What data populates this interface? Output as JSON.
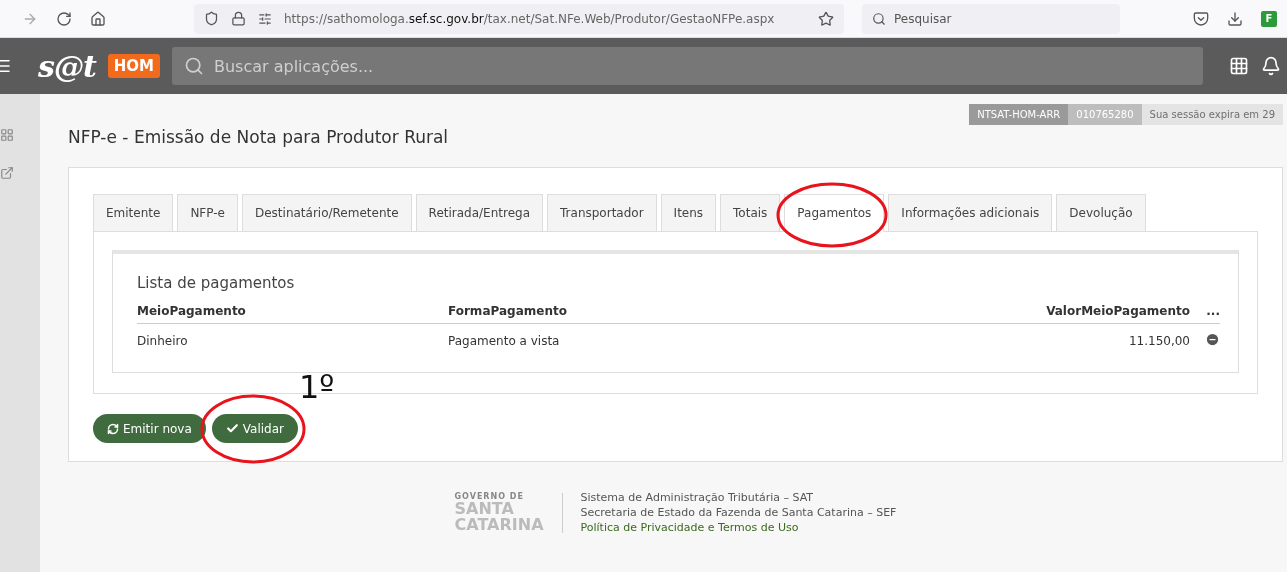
{
  "browser": {
    "url_prefix": "https://sathomologa.",
    "url_domain": "sef.sc.gov.br",
    "url_path": "/tax.net/Sat.NFe.Web/Produtor/GestaoNFPe.aspx",
    "search_placeholder": "Pesquisar",
    "extension_label": "F"
  },
  "header": {
    "logo": "s@t",
    "env_badge": "HOM",
    "search_placeholder": "Buscar aplicações..."
  },
  "session": [
    "NTSAT-HOM-ARR",
    "010765280",
    "Sua sessão expira em 29"
  ],
  "page_title": "NFP-e - Emissão de Nota para Produtor Rural",
  "tabs": [
    {
      "label": "Emitente",
      "selected": false,
      "circled": false
    },
    {
      "label": "NFP-e",
      "selected": false,
      "circled": false
    },
    {
      "label": "Destinatário/Remetente",
      "selected": false,
      "circled": false
    },
    {
      "label": "Retirada/Entrega",
      "selected": false,
      "circled": false
    },
    {
      "label": "Transportador",
      "selected": false,
      "circled": false
    },
    {
      "label": "Itens",
      "selected": false,
      "circled": false
    },
    {
      "label": "Totais",
      "selected": false,
      "circled": false
    },
    {
      "label": "Pagamentos",
      "selected": true,
      "circled": true
    },
    {
      "label": "Informações adicionais",
      "selected": false,
      "circled": false
    },
    {
      "label": "Devolução",
      "selected": false,
      "circled": false
    }
  ],
  "payments": {
    "title": "Lista de pagamentos",
    "columns": [
      "MeioPagamento",
      "FormaPagamento",
      "ValorMeioPagamento",
      "..."
    ],
    "rows": [
      [
        "Dinheiro",
        "Pagamento a vista",
        "11.150,00"
      ]
    ]
  },
  "annotation": "1º",
  "buttons": [
    {
      "kind": "refresh",
      "label": "Emitir nova",
      "circled": false
    },
    {
      "kind": "check",
      "label": "Validar",
      "circled": true
    }
  ],
  "footer": {
    "logo_small": "GOVERNO DE",
    "logo_big": [
      "SANTA",
      "CATARINA"
    ],
    "lines": [
      "Sistema de Administração Tributária – SAT",
      "Secretaria de Estado da Fazenda de Santa Catarina – SEF"
    ],
    "link": "Política de Privacidade e Termos de Uso"
  }
}
